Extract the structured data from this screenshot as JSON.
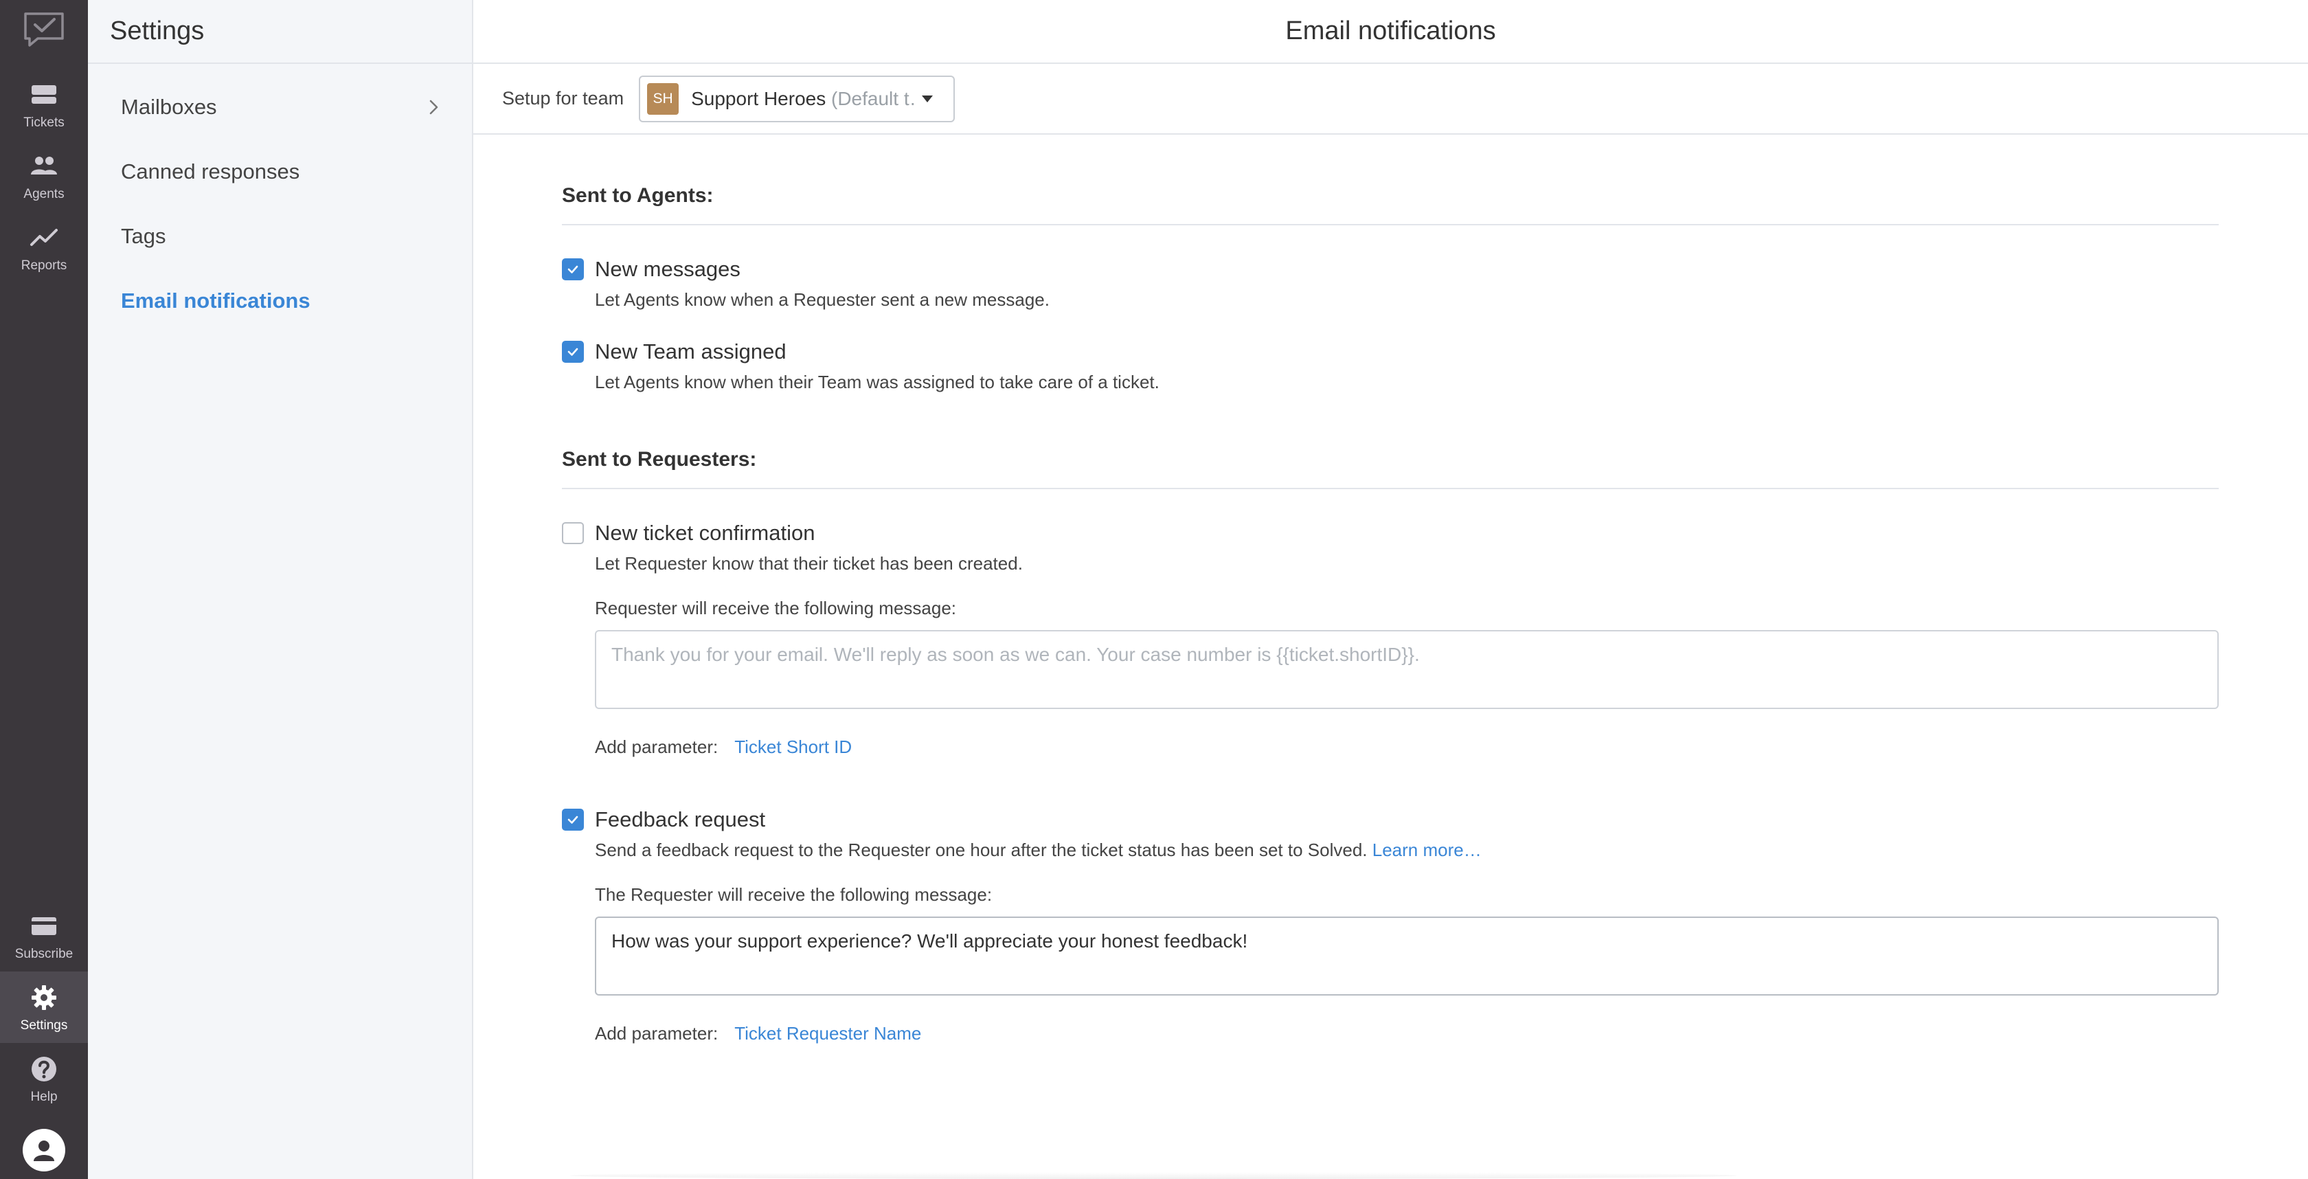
{
  "rail": {
    "items": [
      {
        "id": "tickets",
        "label": "Tickets",
        "icon": "tickets-icon"
      },
      {
        "id": "agents",
        "label": "Agents",
        "icon": "agents-icon"
      },
      {
        "id": "reports",
        "label": "Reports",
        "icon": "reports-icon"
      },
      {
        "id": "subscribe",
        "label": "Subscribe",
        "icon": "card-icon"
      },
      {
        "id": "settings",
        "label": "Settings",
        "icon": "gear-icon",
        "active": true
      },
      {
        "id": "help",
        "label": "Help",
        "icon": "help-icon"
      }
    ]
  },
  "sidebar": {
    "title": "Settings",
    "items": [
      {
        "label": "Mailboxes",
        "has_chevron": true
      },
      {
        "label": "Canned responses"
      },
      {
        "label": "Tags"
      },
      {
        "label": "Email notifications",
        "active": true
      }
    ]
  },
  "main": {
    "title": "Email notifications",
    "team_bar": {
      "label": "Setup for team",
      "badge": "SH",
      "team_name": "Support Heroes",
      "team_suffix": "(Default t…"
    },
    "sections": {
      "agents": {
        "title": "Sent to Agents:",
        "options": [
          {
            "title": "New messages",
            "desc": "Let Agents know when a Requester sent a new message.",
            "checked": true
          },
          {
            "title": "New Team assigned",
            "desc": "Let Agents know when their Team was assigned to take care of a ticket.",
            "checked": true
          }
        ]
      },
      "requesters": {
        "title": "Sent to Requesters:",
        "confirmation": {
          "title": "New ticket confirmation",
          "desc": "Let Requester know that their ticket has been created.",
          "checked": false,
          "field_label": "Requester will receive the following message:",
          "placeholder": "Thank you for your email. We'll reply as soon as we can. Your case number is {{ticket.shortID}}.",
          "param_label": "Add parameter:",
          "param_link": "Ticket Short ID"
        },
        "feedback": {
          "title": "Feedback request",
          "desc": "Send a feedback request to the Requester one hour after the ticket status has been set to Solved.",
          "learn_more": "Learn more…",
          "checked": true,
          "field_label": "The Requester will receive the following message:",
          "value": "How was your support experience? We'll appreciate your honest feedback!",
          "param_label": "Add parameter:",
          "param_link": "Ticket Requester Name"
        }
      }
    }
  },
  "colors": {
    "rail_bg": "#3b373c",
    "accent": "#3a86d6",
    "team_badge": "#b78a57"
  }
}
